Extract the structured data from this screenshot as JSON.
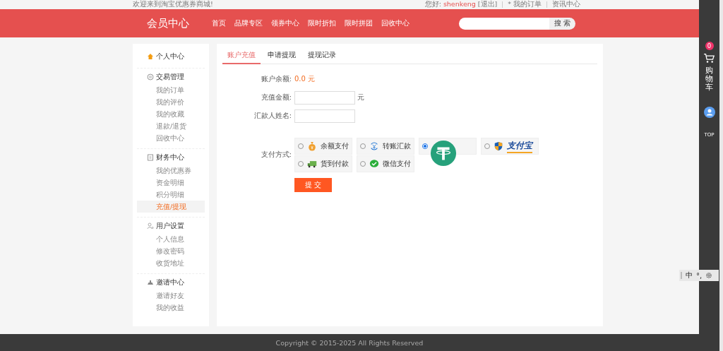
{
  "top_bar": {
    "welcome": "欢迎来到淘宝优惠券商城!",
    "greeting": "您好:",
    "username": "shenkeng",
    "logout": "[退出]",
    "links": [
      "* 我的订单",
      "资讯中心"
    ]
  },
  "header": {
    "title": "会员中心",
    "nav": [
      "首页",
      "品牌专区",
      "领券中心",
      "限时折扣",
      "限时拼团",
      "回收中心"
    ],
    "search": {
      "button": "搜 索"
    }
  },
  "sidebar": {
    "groups": [
      {
        "title": "个人中心"
      },
      {
        "title": "交易管理",
        "items": [
          {
            "label": "我的订单",
            "selected": false
          },
          {
            "label": "我的评价",
            "selected": false
          },
          {
            "label": "我的收藏",
            "selected": false
          },
          {
            "label": "退款/退货",
            "selected": false
          },
          {
            "label": "回收中心",
            "selected": false
          }
        ]
      },
      {
        "title": "财务中心",
        "items": [
          {
            "label": "我的优惠券",
            "selected": false
          },
          {
            "label": "资金明细",
            "selected": false
          },
          {
            "label": "积分明细",
            "selected": false
          },
          {
            "label": "充值/提现",
            "selected": true
          }
        ]
      },
      {
        "title": "用户设置",
        "items": [
          {
            "label": "个人信息",
            "selected": false
          },
          {
            "label": "修改密码",
            "selected": false
          },
          {
            "label": "收货地址",
            "selected": false
          }
        ]
      },
      {
        "title": "邀请中心",
        "items": [
          {
            "label": "邀请好友",
            "selected": false
          },
          {
            "label": "我的收益",
            "selected": false
          }
        ]
      }
    ]
  },
  "tabs": [
    {
      "label": "账户充值",
      "selected": true
    },
    {
      "label": "申请提现",
      "selected": false
    },
    {
      "label": "提现记录",
      "selected": false
    }
  ],
  "form": {
    "balance_label": "账户余额:",
    "balance": "0.0 元",
    "amount_label": "充值金额:",
    "amount_unit": "元",
    "name_label": "汇款人姓名:",
    "pay_label": "支付方式:",
    "methods": [
      {
        "kind": "balance",
        "label": "余额支付",
        "selected": false
      },
      {
        "kind": "transfer",
        "label": "转账汇款",
        "selected": false
      },
      {
        "kind": "tether",
        "selected": true
      },
      {
        "kind": "alipay",
        "label": "支付宝",
        "selected": false
      },
      {
        "kind": "cod",
        "label": "货到付款",
        "selected": false
      },
      {
        "kind": "wechat",
        "label": "微信支付",
        "selected": false
      }
    ],
    "submit": "提 交"
  },
  "footer": "Copyright © 2015-2025 All Rights Reserved",
  "right_bar": {
    "cart_count": "0",
    "cart_label": "购物车",
    "top_label": "TOP"
  },
  "ime_bar": {
    "mode": "中",
    "punct": "°,"
  }
}
